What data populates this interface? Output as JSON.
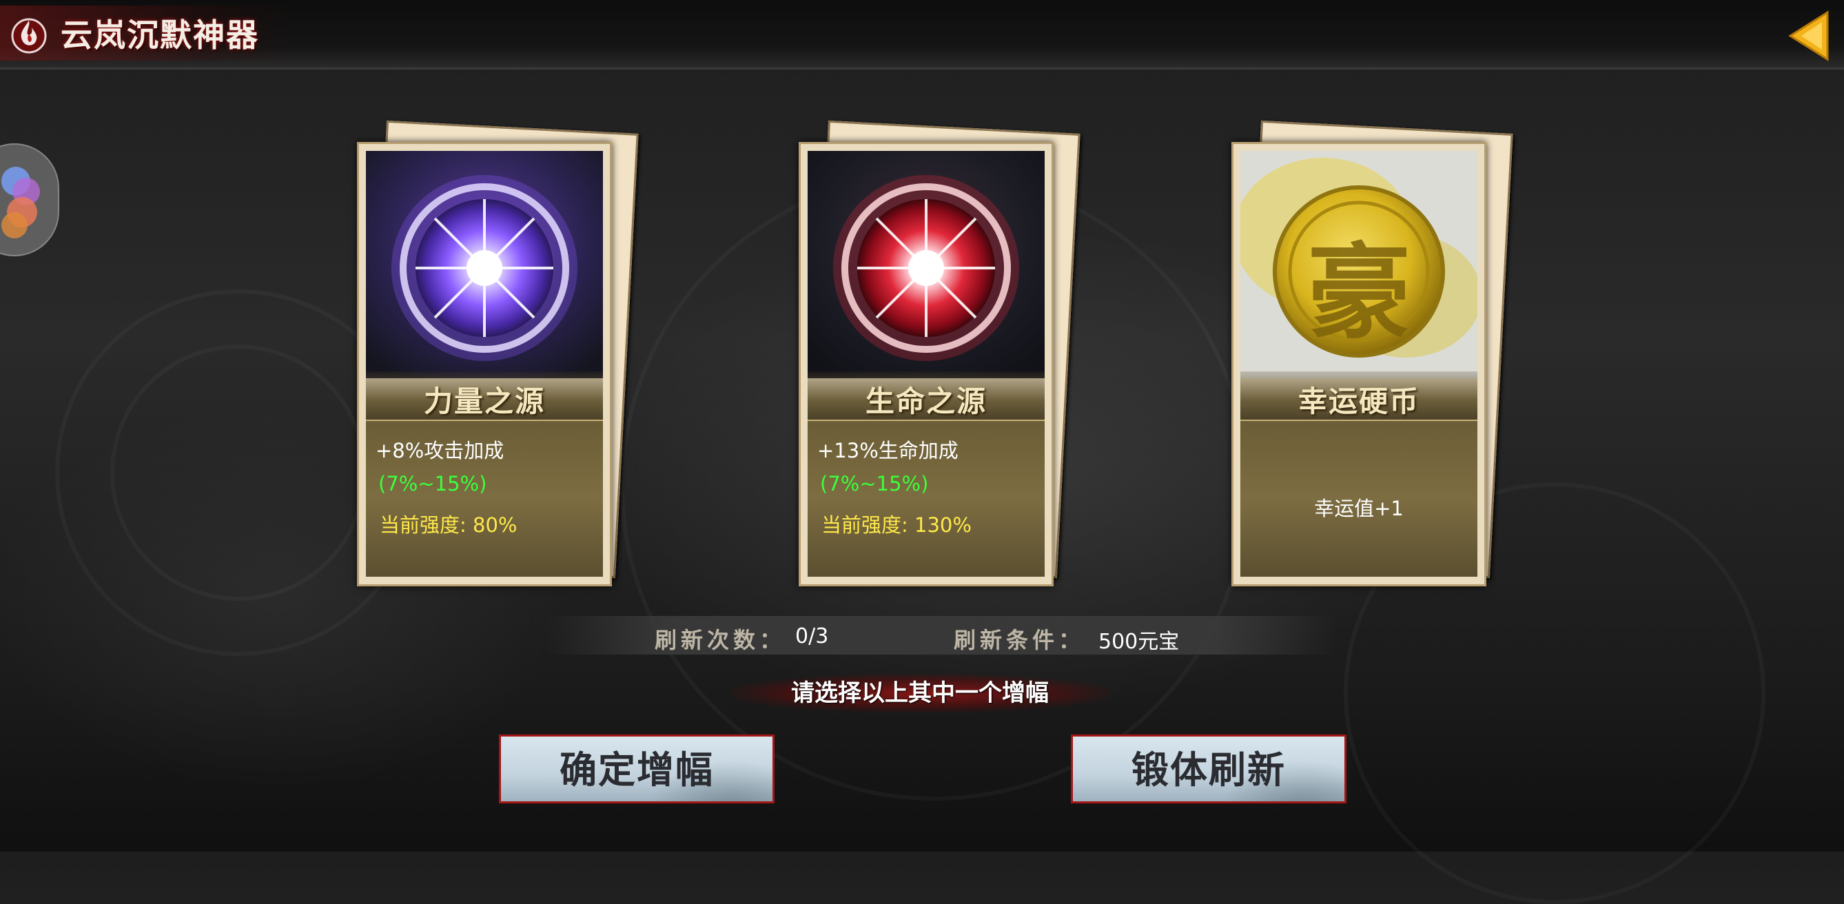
{
  "header": {
    "title": "云岚沉默神器"
  },
  "cards": [
    {
      "name": "力量之源",
      "effect": "+8%攻击加成",
      "range": "(7%~15%)",
      "strength": "当前强度: 80%",
      "orb_color": "#8a5cff"
    },
    {
      "name": "生命之源",
      "effect": "+13%生命加成",
      "range": "(7%~15%)",
      "strength": "当前强度: 130%",
      "orb_color": "#e0283a"
    },
    {
      "name": "幸运硬币",
      "effect": "幸运值+1",
      "coin_glyph": "豪",
      "coin_color": "#d9b51e"
    }
  ],
  "refresh": {
    "count_label": "刷新次数：",
    "count_value": "0/3",
    "condition_label": "刷新条件：",
    "condition_value": "500元宝"
  },
  "prompt": "请选择以上其中一个增幅",
  "buttons": {
    "confirm": "确定增幅",
    "refresh": "锻体刷新"
  },
  "colors": {
    "range_green": "#3cff3c",
    "strength_yellow": "#ffe94a",
    "button_border": "#a61616"
  }
}
